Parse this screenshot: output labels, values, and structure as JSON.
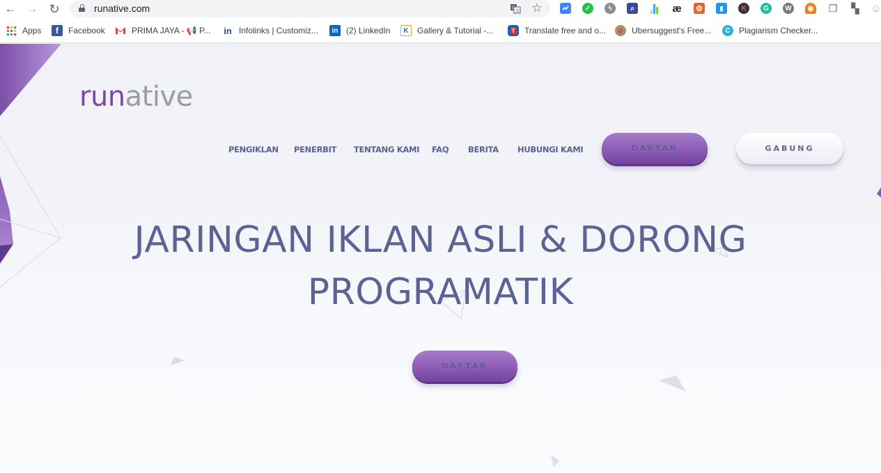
{
  "browser": {
    "url": "runative.com",
    "nav": {
      "back": "←",
      "forward": "→",
      "reload": "↻"
    },
    "omnibox_icons": [
      {
        "name": "translate-icon",
        "glyph": "⇄"
      },
      {
        "name": "bookmark-star-icon",
        "glyph": "☆"
      }
    ],
    "extensions": [
      {
        "name": "extension-checkmark-blue-icon",
        "glyph": "✓",
        "color": "#4285f4"
      },
      {
        "name": "extension-green-check-icon",
        "glyph": "✓",
        "color": "#1fc34a"
      },
      {
        "name": "extension-lightning-icon",
        "glyph": "ϟ",
        "color": "#8a8d91"
      },
      {
        "name": "extension-search-icon",
        "glyph": "⌕",
        "color": "#3b4a9a"
      },
      {
        "name": "extension-bar-chart-icon",
        "glyph": "",
        "color": "#4aa3f0"
      },
      {
        "name": "extension-ae-icon",
        "glyph": "æ",
        "color": "#222222"
      },
      {
        "name": "extension-orange-gear-icon",
        "glyph": "⚙",
        "color": "#e0662a"
      },
      {
        "name": "extension-trash-icon",
        "glyph": "🗑",
        "color": "#2196f3"
      },
      {
        "name": "extension-k-icon",
        "glyph": "K",
        "color": "#2e3640"
      },
      {
        "name": "extension-grammarly-icon",
        "glyph": "G",
        "color": "#15c39a"
      },
      {
        "name": "extension-wordpress-icon",
        "glyph": "W",
        "color": "#777777"
      },
      {
        "name": "extension-robot-icon",
        "glyph": "◉",
        "color": "#f57c1f"
      },
      {
        "name": "extension-copy-icon",
        "glyph": "❐",
        "color": "#9a9a9a"
      },
      {
        "name": "extension-blocks-icon",
        "glyph": "▚",
        "color": "#666666"
      },
      {
        "name": "extension-face-icon",
        "glyph": "☺",
        "color": "#b0b0b0"
      }
    ],
    "bookmarks": [
      {
        "label": "Apps",
        "icon": "apps-grid-icon"
      },
      {
        "label": "Facebook",
        "icon": "facebook-icon"
      },
      {
        "label": "PRIMA JAYA - 📢 P...",
        "icon": "gmail-icon"
      },
      {
        "label": "Infolinks | Customiz...",
        "icon": "infolinks-icon"
      },
      {
        "label": "(2) LinkedIn",
        "icon": "linkedin-icon"
      },
      {
        "label": "Gallery & Tutorial -...",
        "icon": "gallery-k-icon"
      },
      {
        "label": "Translate free and o...",
        "icon": "translate-shield-icon"
      },
      {
        "label": "Ubersuggest's Free...",
        "icon": "ubersuggest-avatar-icon"
      },
      {
        "label": "Plagiarism Checker...",
        "icon": "plagiarism-checker-icon"
      }
    ]
  },
  "site": {
    "logo": {
      "part1": "run",
      "part2": "ative"
    },
    "nav": [
      {
        "label": "PENGIKLAN"
      },
      {
        "label": "PENERBIT"
      },
      {
        "label": "TENTANG KAMI"
      },
      {
        "label": "FAQ"
      },
      {
        "label": "BERITA"
      },
      {
        "label": "HUBUNGI KAMI"
      }
    ],
    "header_buttons": {
      "register": "DAFTAR",
      "join": "GABUNG"
    },
    "hero": {
      "line1": "JARINGAN IKLAN ASLI & DORONG",
      "line2": "PROGRAMATIK",
      "cta": "DAFTAR"
    },
    "colors": {
      "brand_purple": "#7b4a9e",
      "logo_gray": "#979da1",
      "text_navy": "#5c6394",
      "button_purple": "#8c5cb4"
    }
  }
}
